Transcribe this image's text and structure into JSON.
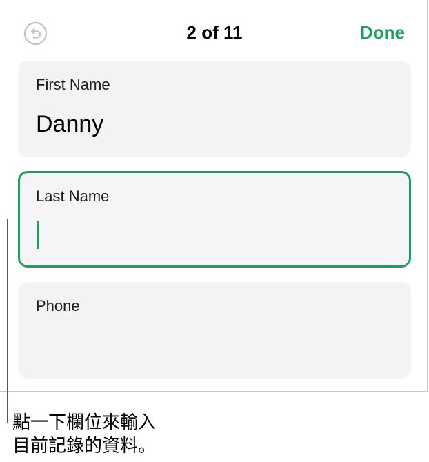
{
  "nav": {
    "title": "2 of 11",
    "done_label": "Done"
  },
  "fields": [
    {
      "label": "First Name",
      "value": "Danny"
    },
    {
      "label": "Last Name",
      "value": ""
    },
    {
      "label": "Phone",
      "value": ""
    }
  ],
  "caption": {
    "line1": "點一下欄位來輸入",
    "line2": "目前記錄的資料。"
  },
  "colors": {
    "accent": "#1fa05a",
    "field_bg": "#f3f3f6"
  }
}
